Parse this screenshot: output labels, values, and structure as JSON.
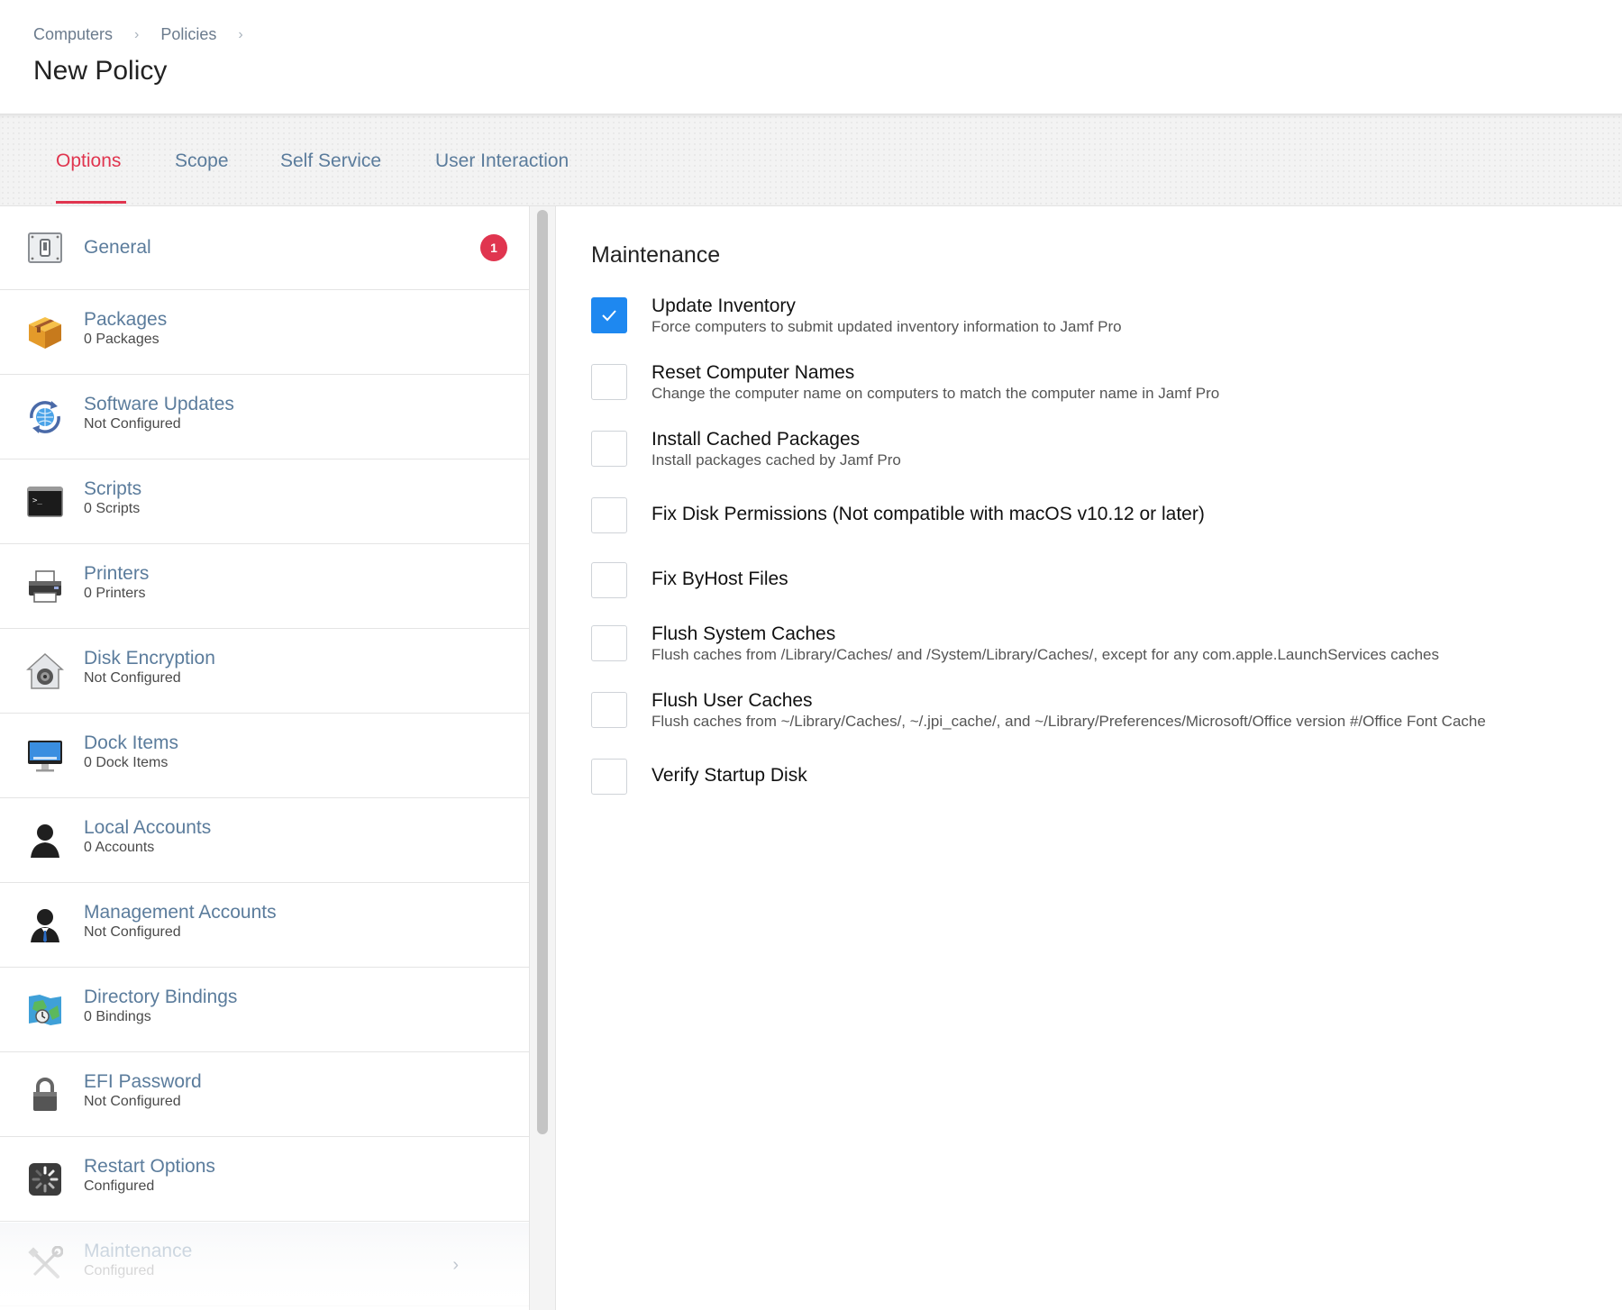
{
  "breadcrumb": {
    "items": [
      "Computers",
      "Policies"
    ]
  },
  "page": {
    "title": "New Policy"
  },
  "tabs": [
    {
      "label": "Options",
      "active": true
    },
    {
      "label": "Scope",
      "active": false
    },
    {
      "label": "Self Service",
      "active": false
    },
    {
      "label": "User Interaction",
      "active": false
    }
  ],
  "sidebar": {
    "items": [
      {
        "title": "General",
        "subtitle": "",
        "icon": "toggle-switch-icon",
        "badge": "1"
      },
      {
        "title": "Packages",
        "subtitle": "0 Packages",
        "icon": "package-box-icon"
      },
      {
        "title": "Software Updates",
        "subtitle": "Not Configured",
        "icon": "software-update-globe-icon"
      },
      {
        "title": "Scripts",
        "subtitle": "0 Scripts",
        "icon": "terminal-icon"
      },
      {
        "title": "Printers",
        "subtitle": "0 Printers",
        "icon": "printer-icon"
      },
      {
        "title": "Disk Encryption",
        "subtitle": "Not Configured",
        "icon": "filevault-house-icon"
      },
      {
        "title": "Dock Items",
        "subtitle": "0 Dock Items",
        "icon": "monitor-dock-icon"
      },
      {
        "title": "Local Accounts",
        "subtitle": "0 Accounts",
        "icon": "user-silhouette-icon"
      },
      {
        "title": "Management Accounts",
        "subtitle": "Not Configured",
        "icon": "manager-silhouette-icon"
      },
      {
        "title": "Directory Bindings",
        "subtitle": "0 Bindings",
        "icon": "directory-map-icon"
      },
      {
        "title": "EFI Password",
        "subtitle": "Not Configured",
        "icon": "padlock-icon"
      },
      {
        "title": "Restart Options",
        "subtitle": "Configured",
        "icon": "restart-spinner-icon"
      },
      {
        "title": "Maintenance",
        "subtitle": "Configured",
        "icon": "tools-wrench-icon",
        "selected": true
      }
    ]
  },
  "main": {
    "section_title": "Maintenance",
    "options": [
      {
        "label": "Update Inventory",
        "description": "Force computers to submit updated inventory information to Jamf Pro",
        "checked": true
      },
      {
        "label": "Reset Computer Names",
        "description": "Change the computer name on computers to match the computer name in Jamf Pro",
        "checked": false
      },
      {
        "label": "Install Cached Packages",
        "description": "Install packages cached by Jamf Pro",
        "checked": false
      },
      {
        "label": "Fix Disk Permissions (Not compatible with macOS v10.12 or later)",
        "description": "",
        "checked": false
      },
      {
        "label": "Fix ByHost Files",
        "description": "",
        "checked": false
      },
      {
        "label": "Flush System Caches",
        "description": "Flush caches from /Library/Caches/ and /System/Library/Caches/, except for any com.apple.LaunchServices caches",
        "checked": false
      },
      {
        "label": "Flush User Caches",
        "description": "Flush caches from ~/Library/Caches/, ~/.jpi_cache/, and ~/Library/Preferences/Microsoft/Office version #/Office Font Cache",
        "checked": false
      },
      {
        "label": "Verify Startup Disk",
        "description": "",
        "checked": false
      }
    ]
  },
  "colors": {
    "accent_red": "#e0354f",
    "link_blue": "#5b7c9c",
    "checkbox_blue": "#1e88f0"
  }
}
